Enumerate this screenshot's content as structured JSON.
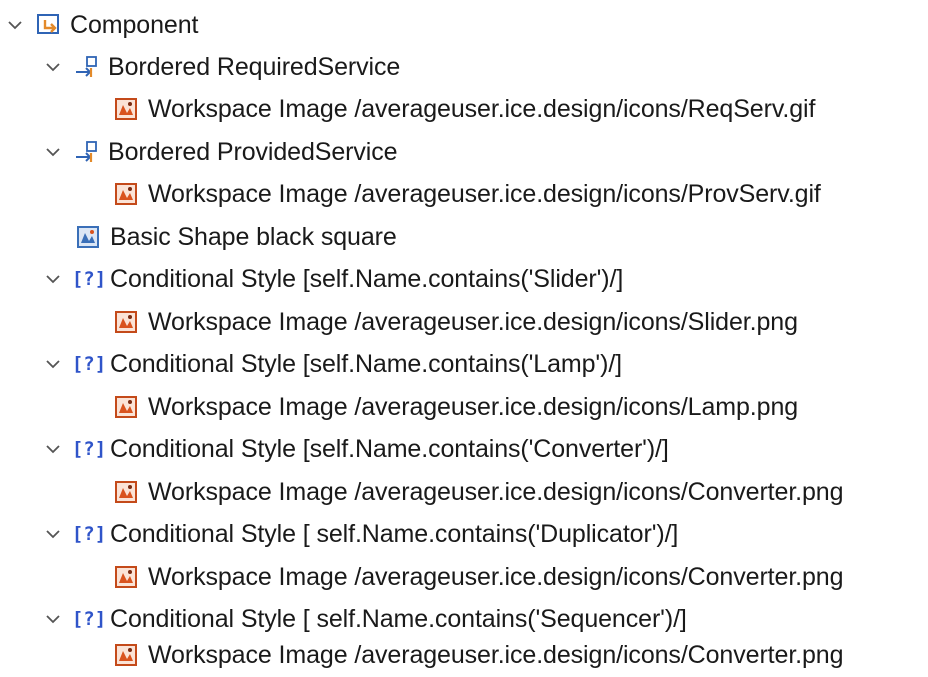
{
  "tree": {
    "root": {
      "label": "Component",
      "icon": "container-arrow-icon"
    },
    "items": [
      {
        "label": "Bordered RequiredService",
        "icon": "bordered-node-icon"
      },
      {
        "label": "Workspace Image /averageuser.ice.design/icons/ReqServ.gif",
        "icon": "workspace-image-icon"
      },
      {
        "label": "Bordered ProvidedService",
        "icon": "bordered-node-icon"
      },
      {
        "label": "Workspace Image /averageuser.ice.design/icons/ProvServ.gif",
        "icon": "workspace-image-icon"
      },
      {
        "label": "Basic Shape black square",
        "icon": "basic-shape-icon"
      },
      {
        "label": "Conditional Style [self.Name.contains('Slider')/]",
        "icon": "conditional-style-icon",
        "glyph": "[?]"
      },
      {
        "label": "Workspace Image /averageuser.ice.design/icons/Slider.png",
        "icon": "workspace-image-icon"
      },
      {
        "label": "Conditional Style [self.Name.contains('Lamp')/]",
        "icon": "conditional-style-icon",
        "glyph": "[?]"
      },
      {
        "label": "Workspace Image /averageuser.ice.design/icons/Lamp.png",
        "icon": "workspace-image-icon"
      },
      {
        "label": "Conditional Style [self.Name.contains('Converter')/]",
        "icon": "conditional-style-icon",
        "glyph": "[?]"
      },
      {
        "label": "Workspace Image /averageuser.ice.design/icons/Converter.png",
        "icon": "workspace-image-icon"
      },
      {
        "label": "Conditional Style [ self.Name.contains('Duplicator')/]",
        "icon": "conditional-style-icon",
        "glyph": "[?]"
      },
      {
        "label": "Workspace Image /averageuser.ice.design/icons/Converter.png",
        "icon": "workspace-image-icon"
      },
      {
        "label": "Conditional Style [ self.Name.contains('Sequencer')/]",
        "icon": "conditional-style-icon",
        "glyph": "[?]"
      },
      {
        "label": "Workspace Image /averageuser.ice.design/icons/Converter.png",
        "icon": "workspace-image-icon"
      }
    ]
  },
  "colors": {
    "twisty": "#555555",
    "conditional": "#2f54c9",
    "image_icon_orange": "#d9531e",
    "shape_icon_blue": "#3a6fb8"
  }
}
